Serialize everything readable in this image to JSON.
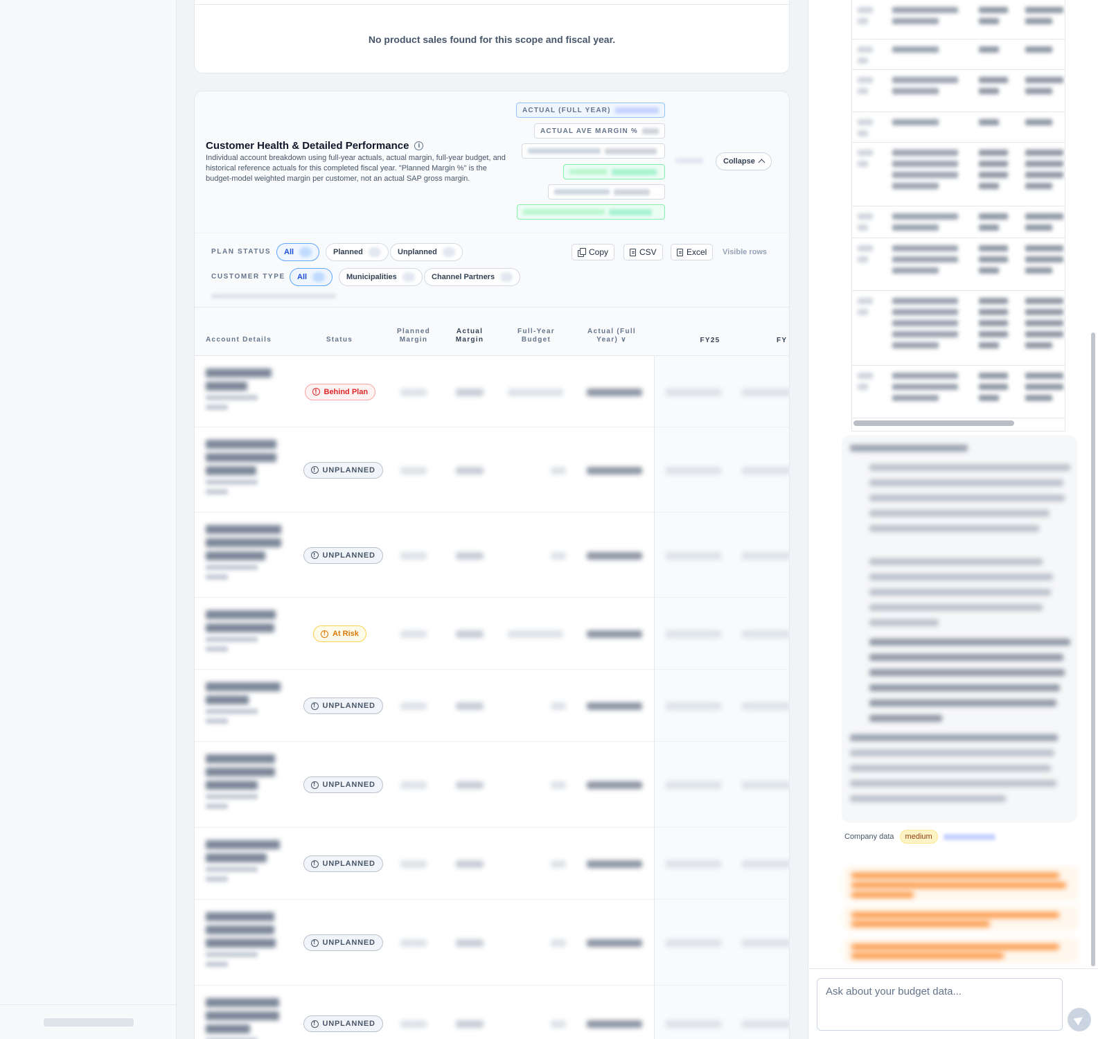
{
  "empty_state": {
    "message": "No product sales found for this scope and fiscal year."
  },
  "health_card": {
    "title": "Customer Health & Detailed Performance",
    "description": "Individual account breakdown using full-year actuals, actual margin, full-year budget, and historical reference actuals for this completed fiscal year. \"Planned Margin %\" is the budget-model weighted margin per customer, not an actual SAP gross margin.",
    "kpis": {
      "actual_full_year": "ACTUAL (FULL YEAR)",
      "actual_ave_margin": "ACTUAL AVE MARGIN %"
    },
    "collapse_label": "Collapse"
  },
  "filters": {
    "plan_status_label": "PLAN STATUS",
    "plan_status_options": [
      "All",
      "Planned",
      "Unplanned"
    ],
    "customer_type_label": "CUSTOMER TYPE",
    "customer_type_options": [
      "All",
      "Municipalities",
      "Channel Partners"
    ],
    "actions": {
      "copy": "Copy",
      "csv": "CSV",
      "excel": "Excel",
      "visible_rows": "Visible rows"
    }
  },
  "table": {
    "headers": {
      "account": "Account Details",
      "status": "Status",
      "planned_margin": "Planned Margin",
      "actual_margin": "Actual Margin",
      "full_year_budget": "Full-Year Budget",
      "actual_full_year": "Actual (Full Year) ∨",
      "fy25": "FY25",
      "fy_next": "FY"
    },
    "rows": [
      {
        "status": "Behind Plan",
        "kind": "behind"
      },
      {
        "status": "UNPLANNED",
        "kind": "unplanned"
      },
      {
        "status": "UNPLANNED",
        "kind": "unplanned"
      },
      {
        "status": "At Risk",
        "kind": "risk"
      },
      {
        "status": "UNPLANNED",
        "kind": "unplanned"
      },
      {
        "status": "UNPLANNED",
        "kind": "unplanned"
      },
      {
        "status": "UNPLANNED",
        "kind": "unplanned"
      },
      {
        "status": "UNPLANNED",
        "kind": "unplanned"
      },
      {
        "status": "UNPLANNED",
        "kind": "unplanned"
      }
    ]
  },
  "chat": {
    "meta_source": "Company data",
    "meta_confidence": "medium",
    "input_placeholder": "Ask about your budget data..."
  }
}
